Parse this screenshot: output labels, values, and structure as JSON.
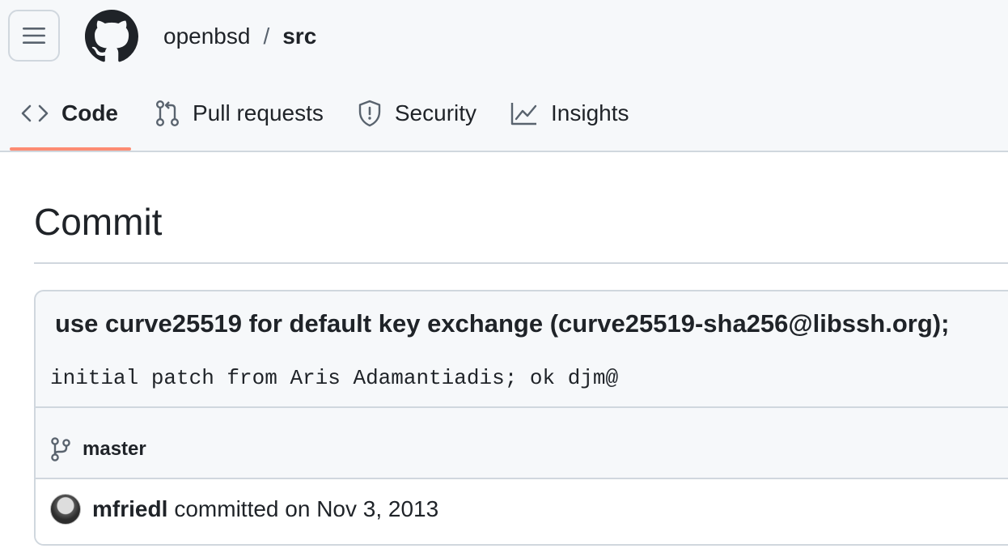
{
  "repo": {
    "owner": "openbsd",
    "separator": "/",
    "name": "src"
  },
  "tabs": [
    {
      "label": "Code",
      "icon": "code-icon",
      "active": true
    },
    {
      "label": "Pull requests",
      "icon": "git-pull-request-icon",
      "active": false
    },
    {
      "label": "Security",
      "icon": "shield-icon",
      "active": false
    },
    {
      "label": "Insights",
      "icon": "graph-icon",
      "active": false
    }
  ],
  "page": {
    "title": "Commit"
  },
  "commit": {
    "title": "use curve25519 for default key exchange (curve25519-sha256@libssh.org);",
    "body": "initial patch from Aris Adamantiadis; ok djm@",
    "branch": "master",
    "author": "mfriedl",
    "action": "committed on Nov 3, 2013"
  },
  "colors": {
    "accent": "#fd8c73",
    "border": "#d0d7de",
    "header_bg": "#f6f8fa"
  }
}
